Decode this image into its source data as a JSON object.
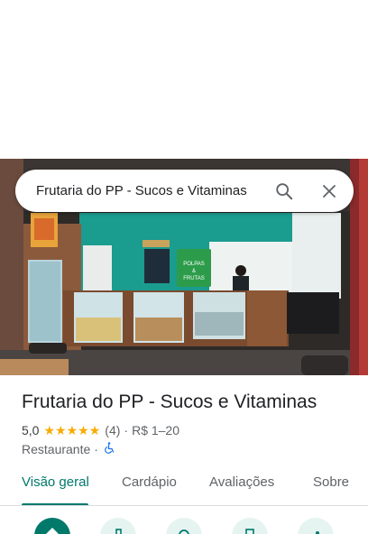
{
  "search": {
    "query": "Frutaria do PP - Sucos e Vitaminas",
    "search_icon": "search-icon",
    "close_icon": "close-icon"
  },
  "photo": {
    "sign_text_1": "POLPAS",
    "sign_text_2": "&",
    "sign_text_3": "FRUTAS"
  },
  "place": {
    "title": "Frutaria do PP - Sucos e Vitaminas",
    "rating": "5,0",
    "stars": 5,
    "review_count": "(4)",
    "separator": "·",
    "price": "R$ 1–20",
    "category": "Restaurante",
    "category_separator": "·",
    "accessibility_icon": "wheelchair-icon"
  },
  "tabs": [
    {
      "label": "Visão geral",
      "active": true
    },
    {
      "label": "Cardápio",
      "active": false
    },
    {
      "label": "Avaliações",
      "active": false
    },
    {
      "label": "Sobre",
      "active": false
    }
  ],
  "actions": [
    {
      "icon": "directions-icon",
      "primary": true
    },
    {
      "icon": "phone-icon",
      "primary": false
    },
    {
      "icon": "nearby-icon",
      "primary": false
    },
    {
      "icon": "save-icon",
      "primary": false
    },
    {
      "icon": "share-icon",
      "primary": false
    }
  ],
  "colors": {
    "accent": "#00796b",
    "star": "#f9ab00",
    "wall_teal": "#1a9c8f"
  }
}
